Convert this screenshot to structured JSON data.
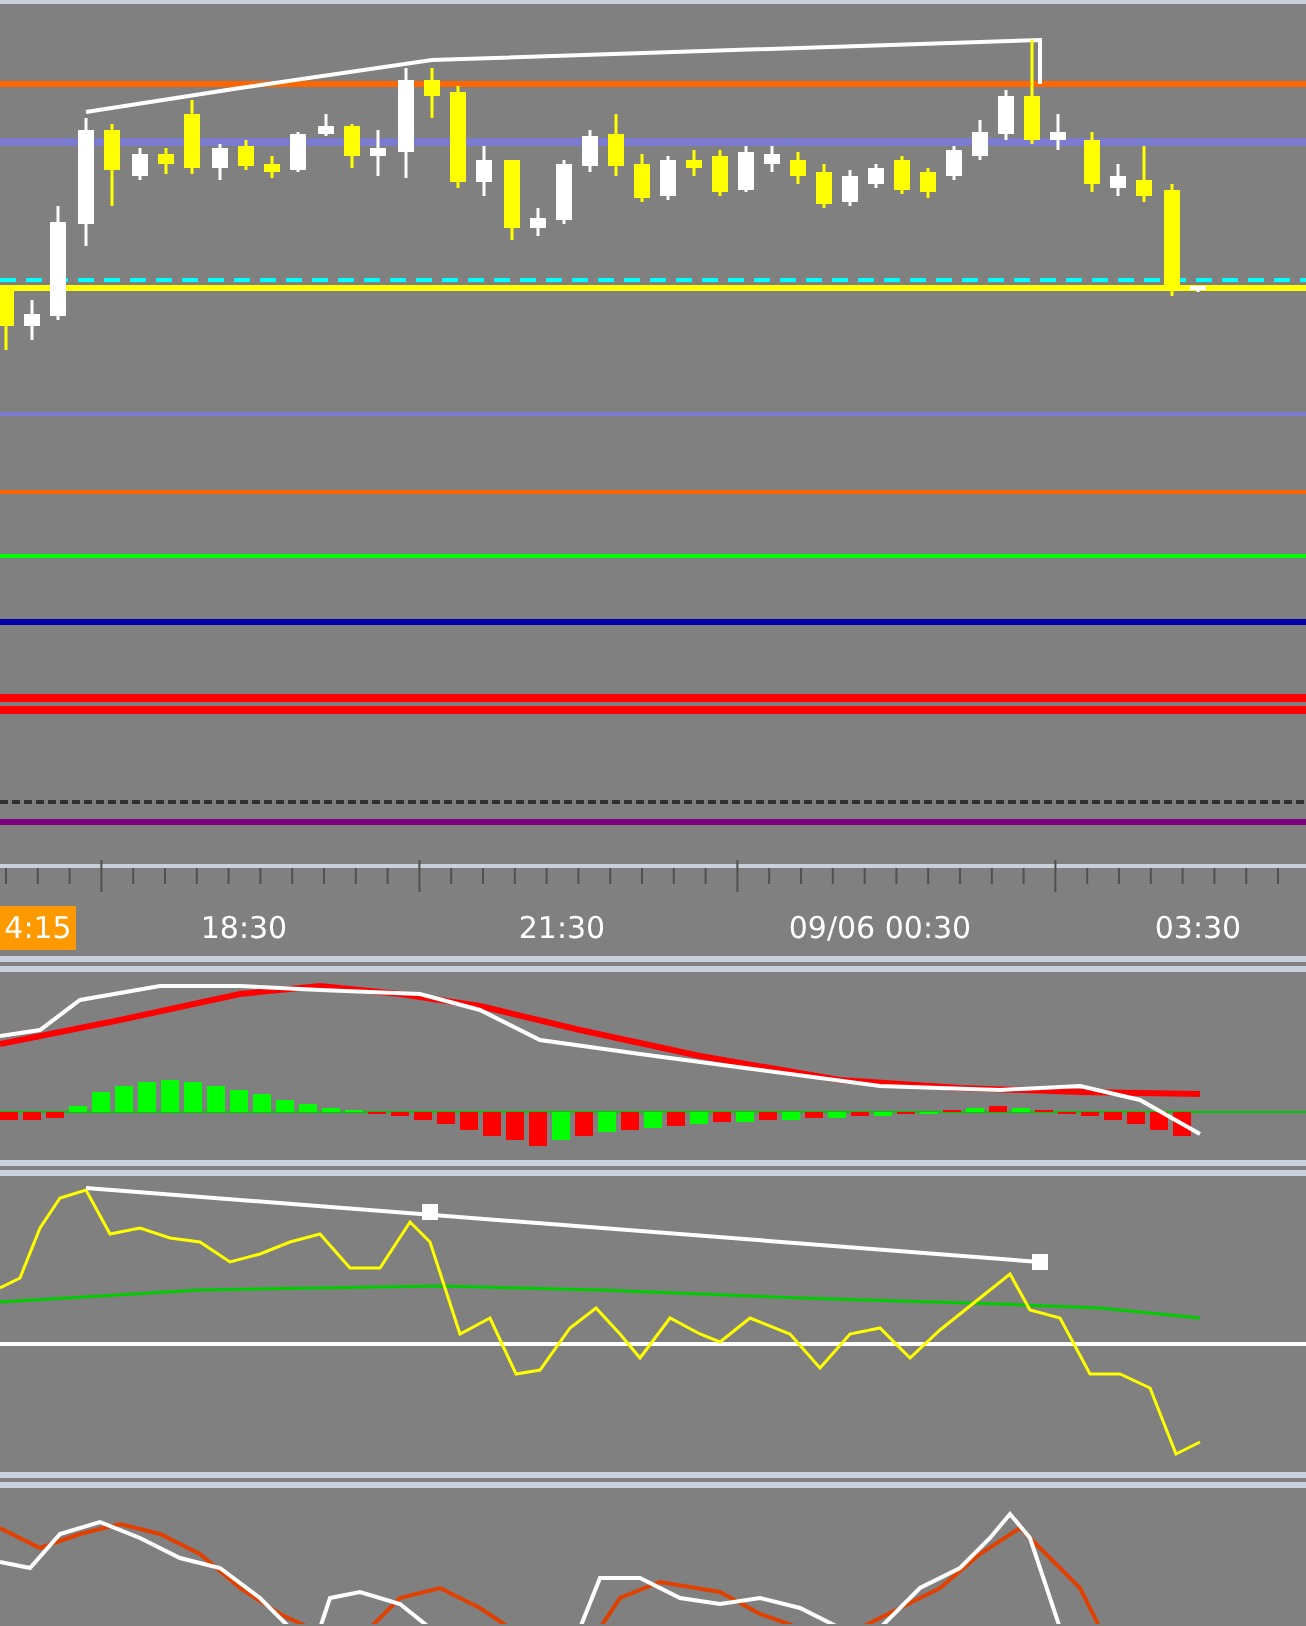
{
  "time_axis": {
    "labels": [
      {
        "text": "4:15",
        "current": true
      },
      {
        "text": "18:30",
        "current": false
      },
      {
        "text": "21:30",
        "current": false
      },
      {
        "text": "09/06 00:30",
        "current": false
      },
      {
        "text": "03:30",
        "current": false
      }
    ]
  }
}
